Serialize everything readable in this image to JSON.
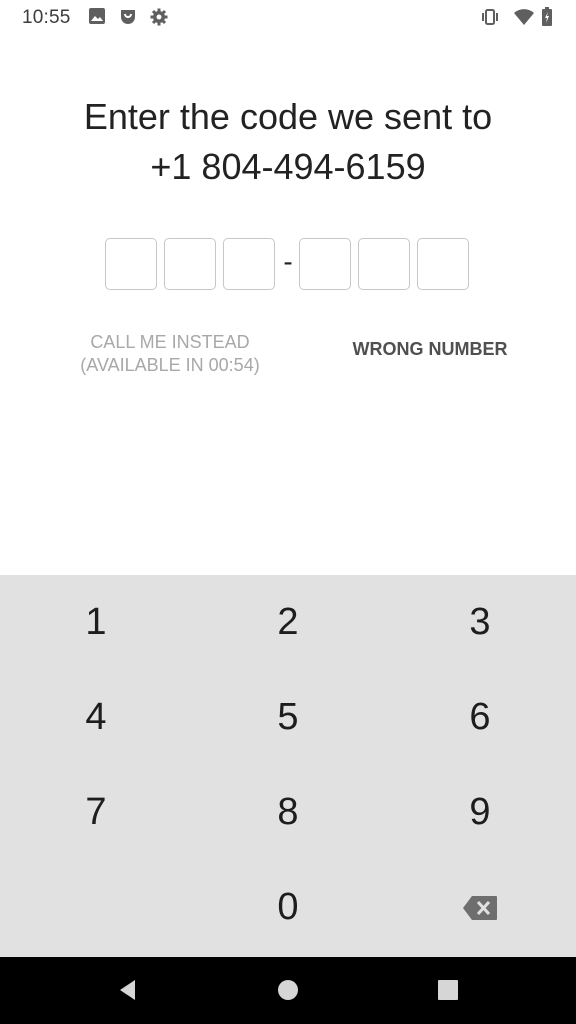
{
  "status_bar": {
    "time": "10:55",
    "left_icons": [
      "image-icon",
      "notification-app-icon",
      "settings-gear-icon"
    ],
    "right_icons": [
      "vibrate-icon",
      "wifi-icon",
      "battery-icon"
    ]
  },
  "verification": {
    "title_line1": "Enter the code we sent to",
    "title_line2": "+1 804-494-6159",
    "code_slots": [
      "",
      "",
      "",
      "",
      "",
      ""
    ],
    "separator": "-",
    "call_me_line1": "CALL ME INSTEAD",
    "call_me_line2": "(AVAILABLE IN 00:54)",
    "wrong_number": "WRONG NUMBER"
  },
  "keypad": {
    "keys": [
      "1",
      "2",
      "3",
      "4",
      "5",
      "6",
      "7",
      "8",
      "9",
      "",
      "0",
      "backspace"
    ],
    "colors": {
      "background": "#e1e1e1",
      "key_text": "#1d1d1d"
    }
  },
  "nav_bar": {
    "buttons": [
      "back-icon",
      "home-icon",
      "recents-icon"
    ]
  },
  "colors": {
    "background": "#ffffff",
    "title": "#222222",
    "disabled_text": "#a8a8a8",
    "action_text": "#505050",
    "box_border": "#c7c7c7",
    "nav_bar": "#000000"
  }
}
